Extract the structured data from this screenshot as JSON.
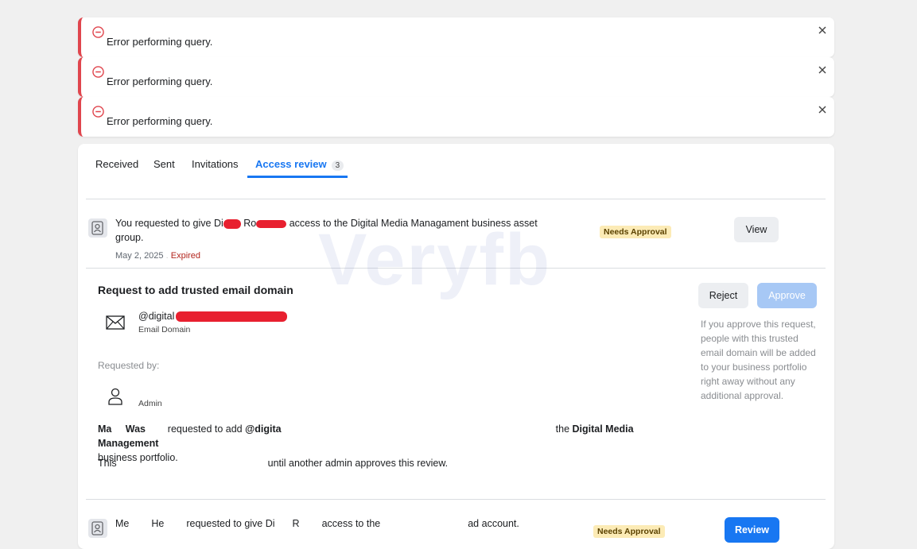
{
  "alerts": [
    {
      "message": "Error performing query."
    },
    {
      "message": "Error performing query."
    },
    {
      "message": "Error performing query."
    }
  ],
  "tabs": [
    {
      "label": "Received"
    },
    {
      "label": "Sent"
    },
    {
      "label": "Invitations"
    },
    {
      "label": "Access review",
      "count": "3"
    }
  ],
  "request1": {
    "text_a": "You requested to give Di",
    "text_b": "Ro",
    "text_c": "access to the Digital Media Managament business asset",
    "text_d": "group.",
    "date": "May 2, 2025",
    "status": "Expired",
    "badge": "Needs Approval",
    "button": "View"
  },
  "domain_request": {
    "title": "Request to add trusted email domain",
    "domain": "@digital",
    "domain_type": "Email Domain",
    "requested_by_label": "Requested by:",
    "requester_role": "Admin",
    "desc1_a": "Ma",
    "desc1_b": "Was",
    "desc1_c": "requested to add",
    "desc1_d": "@digita",
    "desc1_e": "the",
    "desc1_f": "Digital Media Management",
    "desc1_g": "business portfolio.",
    "desc2_a": "This",
    "desc2_b": "until another admin approves this review.",
    "reject": "Reject",
    "approve": "Approve",
    "help": "If you approve this request, people with this trusted email domain will be added to your business portfolio right away without any additional approval."
  },
  "request3": {
    "text_a": "Me",
    "text_b": "He",
    "text_c": "requested to give Di",
    "text_d": "R",
    "text_e": "access to the",
    "text_f": "ad account.",
    "badge": "Needs Approval",
    "button": "Review"
  },
  "watermark": "Veryfb",
  "colors": {
    "accent": "#1877f2",
    "error": "#e0454d",
    "badge_bg": "#fcebb6"
  }
}
